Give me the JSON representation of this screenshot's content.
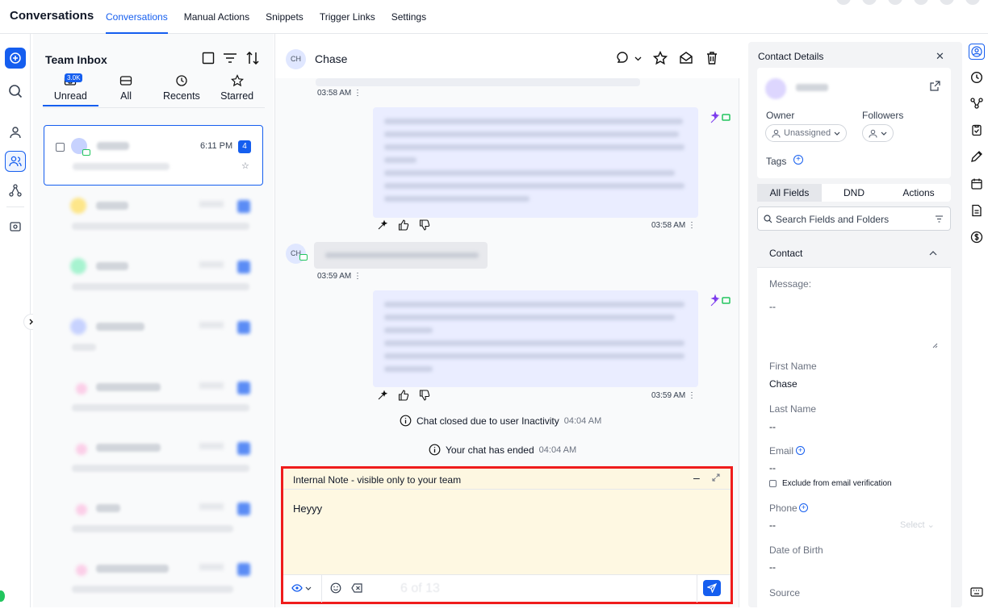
{
  "app": {
    "title": "Conversations"
  },
  "topnav": {
    "tabs": [
      "Conversations",
      "Manual Actions",
      "Snippets",
      "Trigger Links",
      "Settings"
    ]
  },
  "inbox": {
    "title": "Team Inbox",
    "filter_tabs": [
      {
        "label": "Unread",
        "badge": "3.0K"
      },
      {
        "label": "All"
      },
      {
        "label": "Recents"
      },
      {
        "label": "Starred"
      }
    ],
    "selected_conversation": {
      "time": "6:11 PM",
      "unread_count": "4"
    }
  },
  "chat": {
    "contact_initials": "CH",
    "contact_name": "Chase",
    "timestamps": {
      "first": "03:58 AM",
      "bot_reply_1": "03:58 AM",
      "customer_msg": "03:59 AM",
      "bot_reply_2": "03:59 AM"
    },
    "system_messages": [
      {
        "text": "Chat closed due to user Inactivity",
        "time": "04:04 AM"
      },
      {
        "text": "Your chat has ended",
        "time": "04:04 AM"
      }
    ],
    "avatar_small": "CH"
  },
  "composer": {
    "title": "Internal Note - visible only to your team",
    "text": "Heyyy",
    "pager": "6 of 13"
  },
  "contact_details": {
    "title": "Contact Details",
    "owner_label": "Owner",
    "followers_label": "Followers",
    "owner_value": "Unassigned",
    "tags_label": "Tags",
    "tabs": [
      "All Fields",
      "DND",
      "Actions"
    ],
    "search_placeholder": "Search Fields and Folders",
    "section_title": "Contact",
    "fields": {
      "message_label": "Message:",
      "message_value": "--",
      "first_name_label": "First Name",
      "first_name_value": "Chase",
      "last_name_label": "Last Name",
      "last_name_value": "--",
      "email_label": "Email",
      "email_value": "--",
      "exclude_label": "Exclude from email verification",
      "phone_label": "Phone",
      "phone_value": "--",
      "phone_select": "Select",
      "dob_label": "Date of Birth",
      "dob_value": "--",
      "source_label": "Source"
    }
  },
  "colors": {
    "accent": "#155eef",
    "highlight_border": "#ef1c1c",
    "note_bg": "#fef8e2"
  }
}
